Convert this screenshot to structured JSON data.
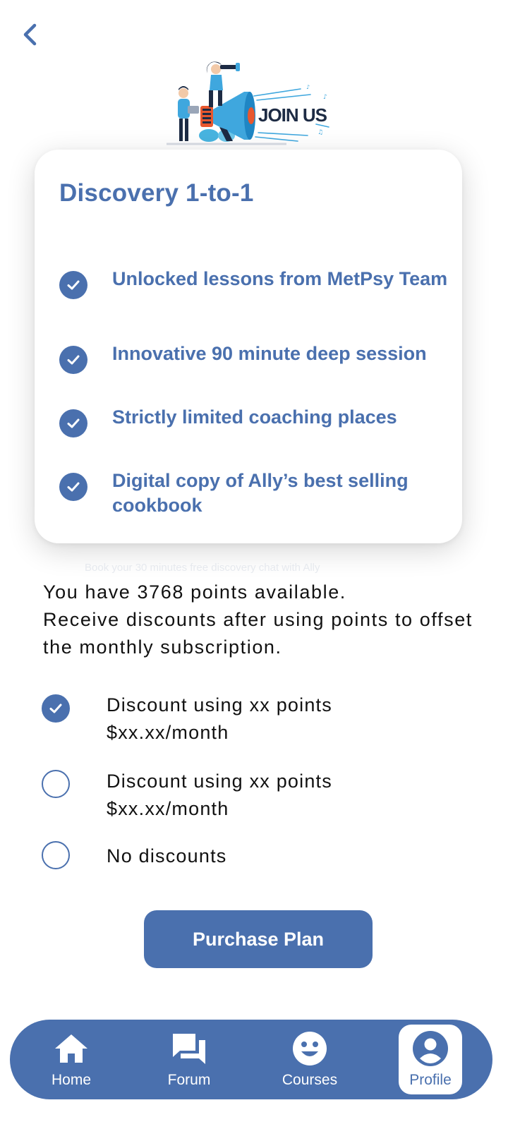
{
  "header": {
    "back_icon": "chevron-left-icon"
  },
  "hero": {
    "logo_text": "JOIN US"
  },
  "card": {
    "title": "Discovery 1-to-1",
    "features": [
      {
        "text": "Unlocked lessons from MetPsy Team"
      },
      {
        "text": "Innovative 90 minute deep session"
      },
      {
        "text": "Strictly limited coaching places"
      },
      {
        "text": "Digital copy of Ally’s best selling cookbook"
      }
    ]
  },
  "faded_text": "Book your 30 minutes free discovery chat with Ally",
  "points": {
    "line1": "You have 3768 points available.",
    "line2": "Receive discounts after using points to offset the monthly subscription."
  },
  "discount_options": [
    {
      "line1": "Discount using xx points",
      "line2": "$xx.xx/month",
      "selected": true
    },
    {
      "line1": "Discount using xx points",
      "line2": "$xx.xx/month",
      "selected": false
    },
    {
      "line1": "No discounts",
      "line2": "",
      "selected": false
    }
  ],
  "purchase_button": {
    "label": "Purchase Plan"
  },
  "nav": {
    "items": [
      {
        "label": "Home",
        "icon": "home-icon",
        "active": false
      },
      {
        "label": "Forum",
        "icon": "forum-icon",
        "active": false
      },
      {
        "label": "Courses",
        "icon": "smiley-icon",
        "active": false
      },
      {
        "label": "Profile",
        "icon": "profile-icon",
        "active": true
      }
    ]
  },
  "colors": {
    "accent": "#4a70ae",
    "text": "#111111",
    "background": "#ffffff"
  }
}
